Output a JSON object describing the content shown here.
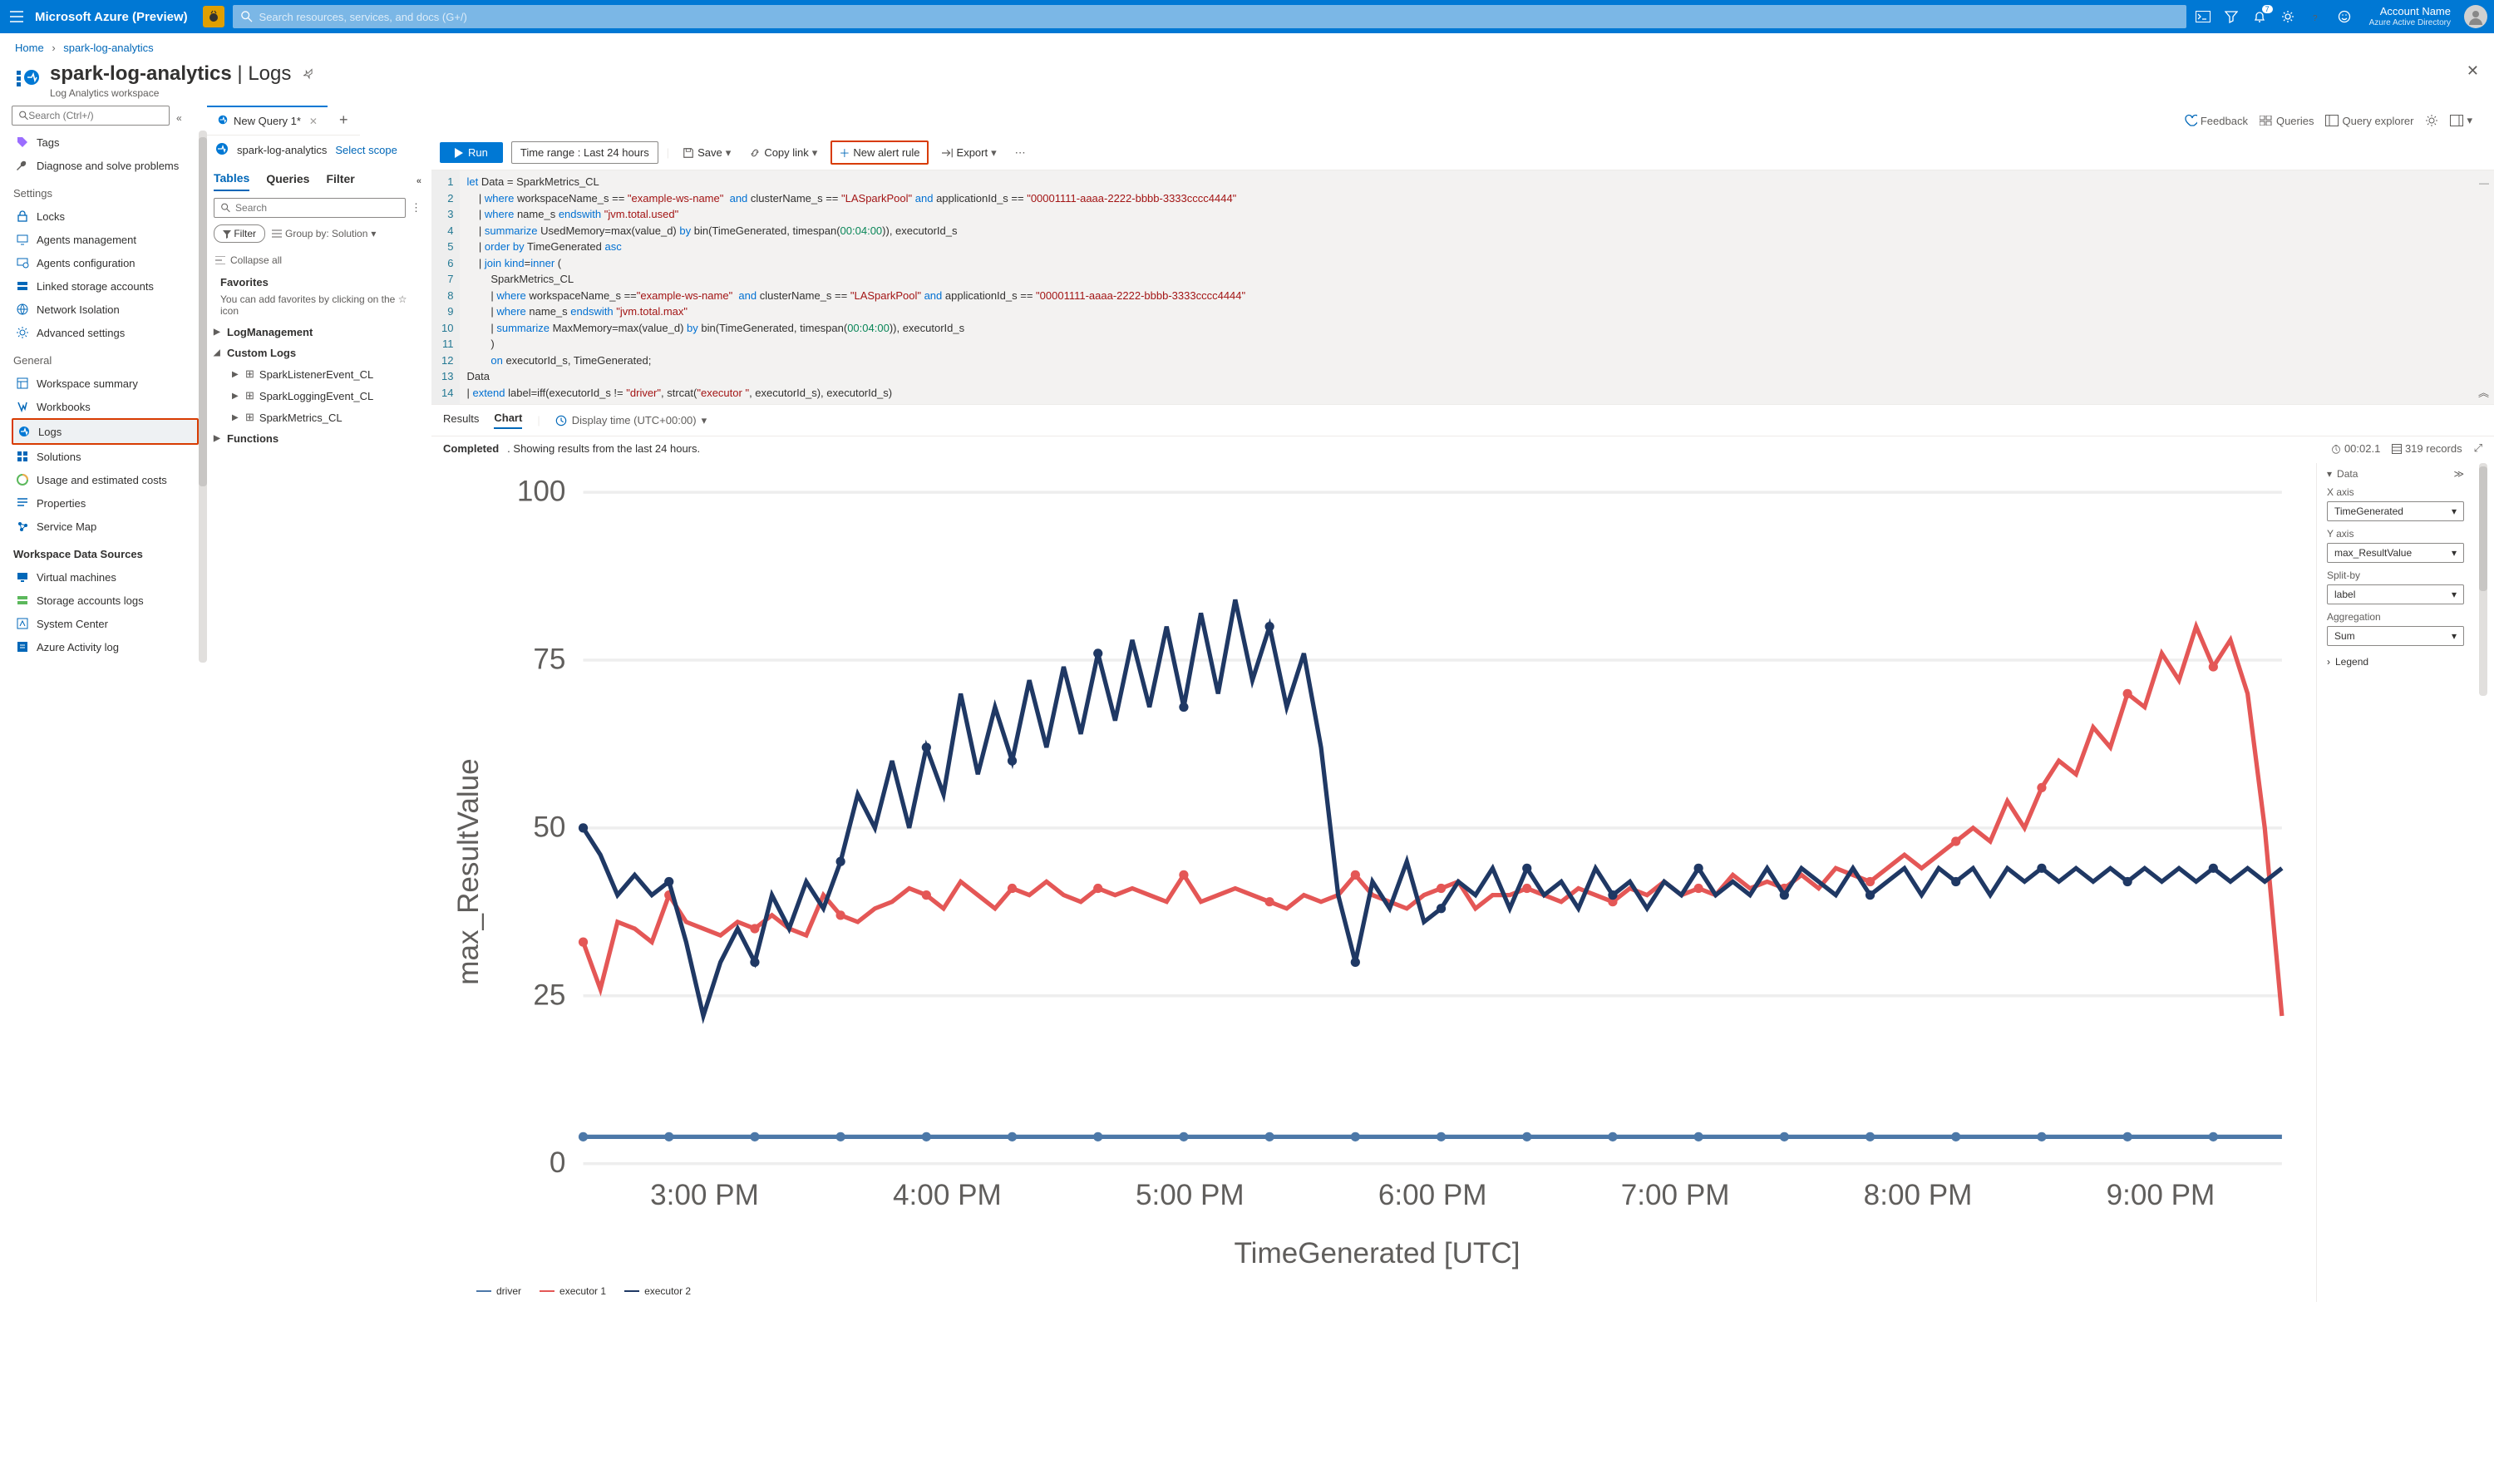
{
  "topbar": {
    "brand": "Microsoft Azure (Preview)",
    "search_placeholder": "Search resources, services, and docs (G+/)",
    "notif_count": "7",
    "account_name": "Account Name",
    "account_dir": "Azure Active Directory"
  },
  "crumbs": {
    "home": "Home",
    "ws": "spark-log-analytics"
  },
  "page": {
    "title_main": "spark-log-analytics",
    "title_sep": " | ",
    "title_sub": "Logs",
    "subtitle": "Log Analytics workspace"
  },
  "leftnav": {
    "search_placeholder": "Search (Ctrl+/)",
    "items_top": [
      {
        "icon": "tag",
        "label": "Tags",
        "color": "#9b6dff"
      },
      {
        "icon": "wrench",
        "label": "Diagnose and solve problems",
        "color": "#323130"
      }
    ],
    "section_settings": "Settings",
    "items_settings": [
      {
        "icon": "lock",
        "label": "Locks"
      },
      {
        "icon": "agent",
        "label": "Agents management"
      },
      {
        "icon": "agentcfg",
        "label": "Agents configuration"
      },
      {
        "icon": "storage",
        "label": "Linked storage accounts"
      },
      {
        "icon": "net",
        "label": "Network Isolation"
      },
      {
        "icon": "gear",
        "label": "Advanced settings"
      }
    ],
    "section_general": "General",
    "items_general": [
      {
        "icon": "summary",
        "label": "Workspace summary"
      },
      {
        "icon": "workbook",
        "label": "Workbooks"
      },
      {
        "icon": "logs",
        "label": "Logs",
        "selected": true
      },
      {
        "icon": "solutions",
        "label": "Solutions"
      },
      {
        "icon": "usage",
        "label": "Usage and estimated costs"
      },
      {
        "icon": "props",
        "label": "Properties"
      },
      {
        "icon": "map",
        "label": "Service Map"
      }
    ],
    "section_wds": "Workspace Data Sources",
    "items_wds": [
      {
        "icon": "vm",
        "label": "Virtual machines"
      },
      {
        "icon": "salog",
        "label": "Storage accounts logs"
      },
      {
        "icon": "sc",
        "label": "System Center"
      },
      {
        "icon": "aal",
        "label": "Azure Activity log"
      }
    ]
  },
  "toprighticons": {
    "feedback": "Feedback",
    "queries": "Queries",
    "qexplorer": "Query explorer"
  },
  "querytabs": {
    "tab1": "New Query 1*"
  },
  "scope": {
    "name": "spark-log-analytics",
    "select": "Select scope"
  },
  "mid": {
    "tab_tables": "Tables",
    "tab_queries": "Queries",
    "tab_filter": "Filter",
    "search_placeholder": "Search",
    "filter_btn": "Filter",
    "groupby": "Group by: Solution",
    "collapse_all": "Collapse all",
    "favorites_title": "Favorites",
    "favorites_sub": "You can add favorites by clicking on the ☆ icon",
    "tree": {
      "logmgmt": "LogManagement",
      "customlogs": "Custom Logs",
      "cl1": "SparkListenerEvent_CL",
      "cl2": "SparkLoggingEvent_CL",
      "cl3": "SparkMetrics_CL",
      "functions": "Functions"
    }
  },
  "querybar": {
    "run": "Run",
    "timerange_label": "Time range : ",
    "timerange_value": "Last 24 hours",
    "save": "Save",
    "copylink": "Copy link",
    "newalert": "New alert rule",
    "export": "Export"
  },
  "editor": {
    "lines": [
      "let Data = SparkMetrics_CL",
      "    | where workspaceName_s == \"example-ws-name\"  and clusterName_s == \"LASparkPool\" and applicationId_s == \"00001111-aaaa-2222-bbbb-3333cccc4444\"",
      "    | where name_s endswith \"jvm.total.used\"",
      "    | summarize UsedMemory=max(value_d) by bin(TimeGenerated, timespan(00:04:00)), executorId_s",
      "    | order by TimeGenerated asc",
      "    | join kind=inner (",
      "        SparkMetrics_CL",
      "        | where workspaceName_s ==\"example-ws-name\"  and clusterName_s == \"LASparkPool\" and applicationId_s == \"00001111-aaaa-2222-bbbb-3333cccc4444\"",
      "        | where name_s endswith \"jvm.total.max\"",
      "        | summarize MaxMemory=max(value_d) by bin(TimeGenerated, timespan(00:04:00)), executorId_s",
      "        )",
      "        on executorId_s, TimeGenerated;",
      "Data",
      "| extend label=iff(executorId_s != \"driver\", strcat(\"executor \", executorId_s), executorId_s)"
    ]
  },
  "resultbar": {
    "results": "Results",
    "chart": "Chart",
    "displaytime": "Display time (UTC+00:00)"
  },
  "status": {
    "completed": "Completed",
    "sub": ". Showing results from the last 24 hours.",
    "time": "00:02.1",
    "records": "319 records"
  },
  "chartside": {
    "data": "Data",
    "xaxis_label": "X axis",
    "xaxis_value": "TimeGenerated",
    "yaxis_label": "Y axis",
    "yaxis_value": "max_ResultValue",
    "splitby_label": "Split-by",
    "splitby_value": "label",
    "agg_label": "Aggregation",
    "agg_value": "Sum",
    "legend": "Legend"
  },
  "chart": {
    "ylabel": "max_ResultValue",
    "xlabel": "TimeGenerated [UTC]",
    "legend": {
      "s1": "driver",
      "s2": "executor 1",
      "s3": "executor 2"
    }
  },
  "chart_data": {
    "type": "line",
    "title": "",
    "xlabel": "TimeGenerated [UTC]",
    "ylabel": "max_ResultValue",
    "ylim": [
      0,
      100
    ],
    "x_ticks": [
      "3:00 PM",
      "4:00 PM",
      "5:00 PM",
      "6:00 PM",
      "7:00 PM",
      "8:00 PM",
      "9:00 PM"
    ],
    "categories_minutes_offset": [
      0,
      4,
      8,
      12,
      16,
      20,
      24,
      28,
      32,
      36,
      40,
      44,
      48,
      52,
      56,
      60,
      64,
      68,
      72,
      76,
      80,
      84,
      88,
      92,
      96,
      100,
      104,
      108,
      112,
      116,
      120,
      124,
      128,
      132,
      136,
      140,
      144,
      148,
      152,
      156,
      160,
      164,
      168,
      172,
      176,
      180,
      184,
      188,
      192,
      196,
      200,
      204,
      208,
      212,
      216,
      220,
      224,
      228,
      232,
      236,
      240,
      244,
      248,
      252,
      256,
      260,
      264,
      268,
      272,
      276,
      280,
      284,
      288,
      292,
      296,
      300,
      304,
      308,
      312,
      316,
      320,
      324,
      328,
      332,
      336,
      340,
      344,
      348,
      352,
      356,
      360,
      364,
      368,
      372,
      376,
      380,
      384,
      388,
      392,
      396
    ],
    "series": [
      {
        "name": "driver",
        "values": [
          4,
          4,
          4,
          4,
          4,
          4,
          4,
          4,
          4,
          4,
          4,
          4,
          4,
          4,
          4,
          4,
          4,
          4,
          4,
          4,
          4,
          4,
          4,
          4,
          4,
          4,
          4,
          4,
          4,
          4,
          4,
          4,
          4,
          4,
          4,
          4,
          4,
          4,
          4,
          4,
          4,
          4,
          4,
          4,
          4,
          4,
          4,
          4,
          4,
          4,
          4,
          4,
          4,
          4,
          4,
          4,
          4,
          4,
          4,
          4,
          4,
          4,
          4,
          4,
          4,
          4,
          4,
          4,
          4,
          4,
          4,
          4,
          4,
          4,
          4,
          4,
          4,
          4,
          4,
          4,
          4,
          4,
          4,
          4,
          4,
          4,
          4,
          4,
          4,
          4,
          4,
          4,
          4,
          4,
          4,
          4,
          4,
          4,
          4,
          4
        ]
      },
      {
        "name": "executor 1",
        "values": [
          33,
          26,
          36,
          35,
          33,
          40,
          36,
          35,
          34,
          36,
          35,
          37,
          35,
          34,
          40,
          37,
          36,
          38,
          39,
          41,
          40,
          38,
          42,
          40,
          38,
          41,
          40,
          42,
          40,
          39,
          41,
          40,
          41,
          40,
          39,
          43,
          39,
          40,
          41,
          40,
          39,
          38,
          40,
          39,
          40,
          43,
          40,
          39,
          38,
          40,
          41,
          42,
          38,
          40,
          40,
          41,
          40,
          39,
          41,
          40,
          39,
          41,
          40,
          42,
          40,
          41,
          40,
          43,
          41,
          42,
          41,
          43,
          41,
          44,
          43,
          42,
          44,
          46,
          44,
          46,
          48,
          50,
          48,
          54,
          50,
          56,
          60,
          58,
          65,
          62,
          70,
          68,
          76,
          72,
          80,
          74,
          78,
          70,
          50,
          22
        ]
      },
      {
        "name": "executor 2",
        "values": [
          50,
          46,
          40,
          43,
          40,
          42,
          33,
          22,
          30,
          35,
          30,
          40,
          35,
          42,
          38,
          45,
          55,
          50,
          60,
          50,
          62,
          55,
          70,
          58,
          68,
          60,
          72,
          62,
          74,
          64,
          76,
          66,
          78,
          68,
          80,
          68,
          82,
          70,
          84,
          72,
          80,
          68,
          76,
          62,
          40,
          30,
          42,
          38,
          45,
          36,
          38,
          42,
          40,
          44,
          38,
          44,
          40,
          42,
          38,
          44,
          40,
          42,
          38,
          42,
          40,
          44,
          40,
          42,
          40,
          44,
          40,
          44,
          42,
          40,
          44,
          40,
          42,
          44,
          40,
          44,
          42,
          44,
          40,
          44,
          42,
          44,
          42,
          44,
          42,
          44,
          42,
          44,
          42,
          44,
          42,
          44,
          42,
          44,
          42,
          44
        ]
      }
    ],
    "legend_position": "bottom"
  }
}
